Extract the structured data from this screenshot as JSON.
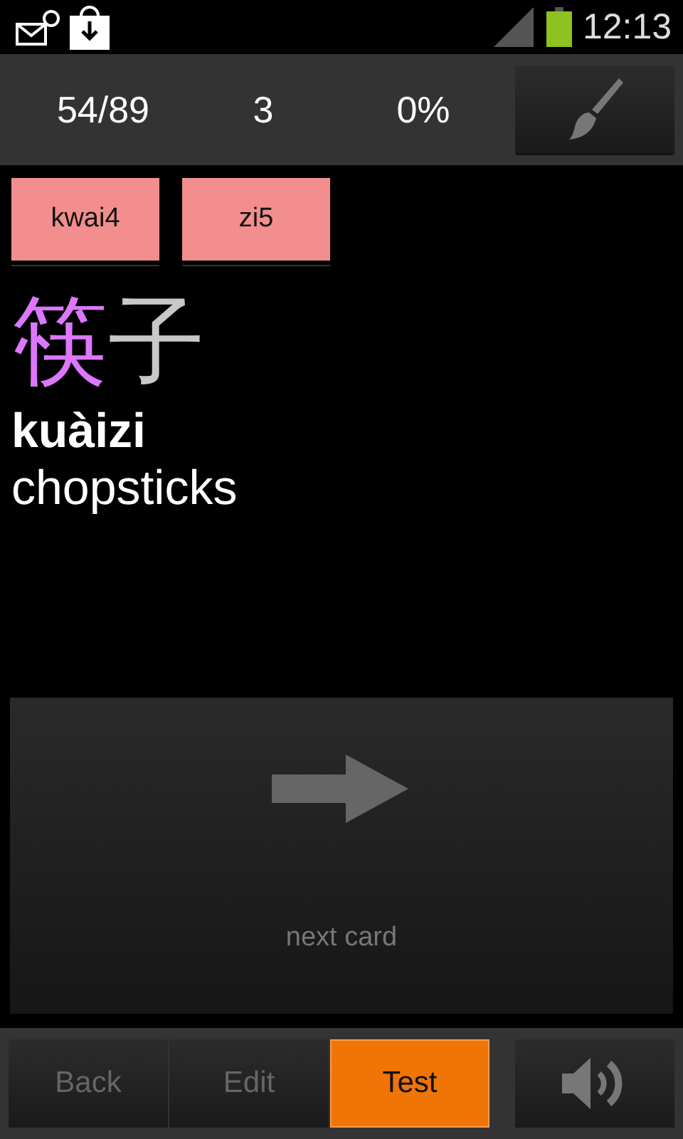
{
  "status_bar": {
    "time": "12:13"
  },
  "stats": [
    "54/89",
    "3",
    "0%"
  ],
  "tones": [
    "kwai4",
    "zi5"
  ],
  "hanzi": [
    {
      "char": "筷",
      "color": "#dd77ff"
    },
    {
      "char": "子",
      "color": "#c8c8c8"
    }
  ],
  "pinyin": "kuàizi",
  "meaning": "chopsticks",
  "next_card": {
    "label": "next card"
  },
  "bottom_tabs": [
    {
      "label": "Back",
      "selected": false
    },
    {
      "label": "Edit",
      "selected": false
    },
    {
      "label": "Test",
      "selected": true
    }
  ]
}
